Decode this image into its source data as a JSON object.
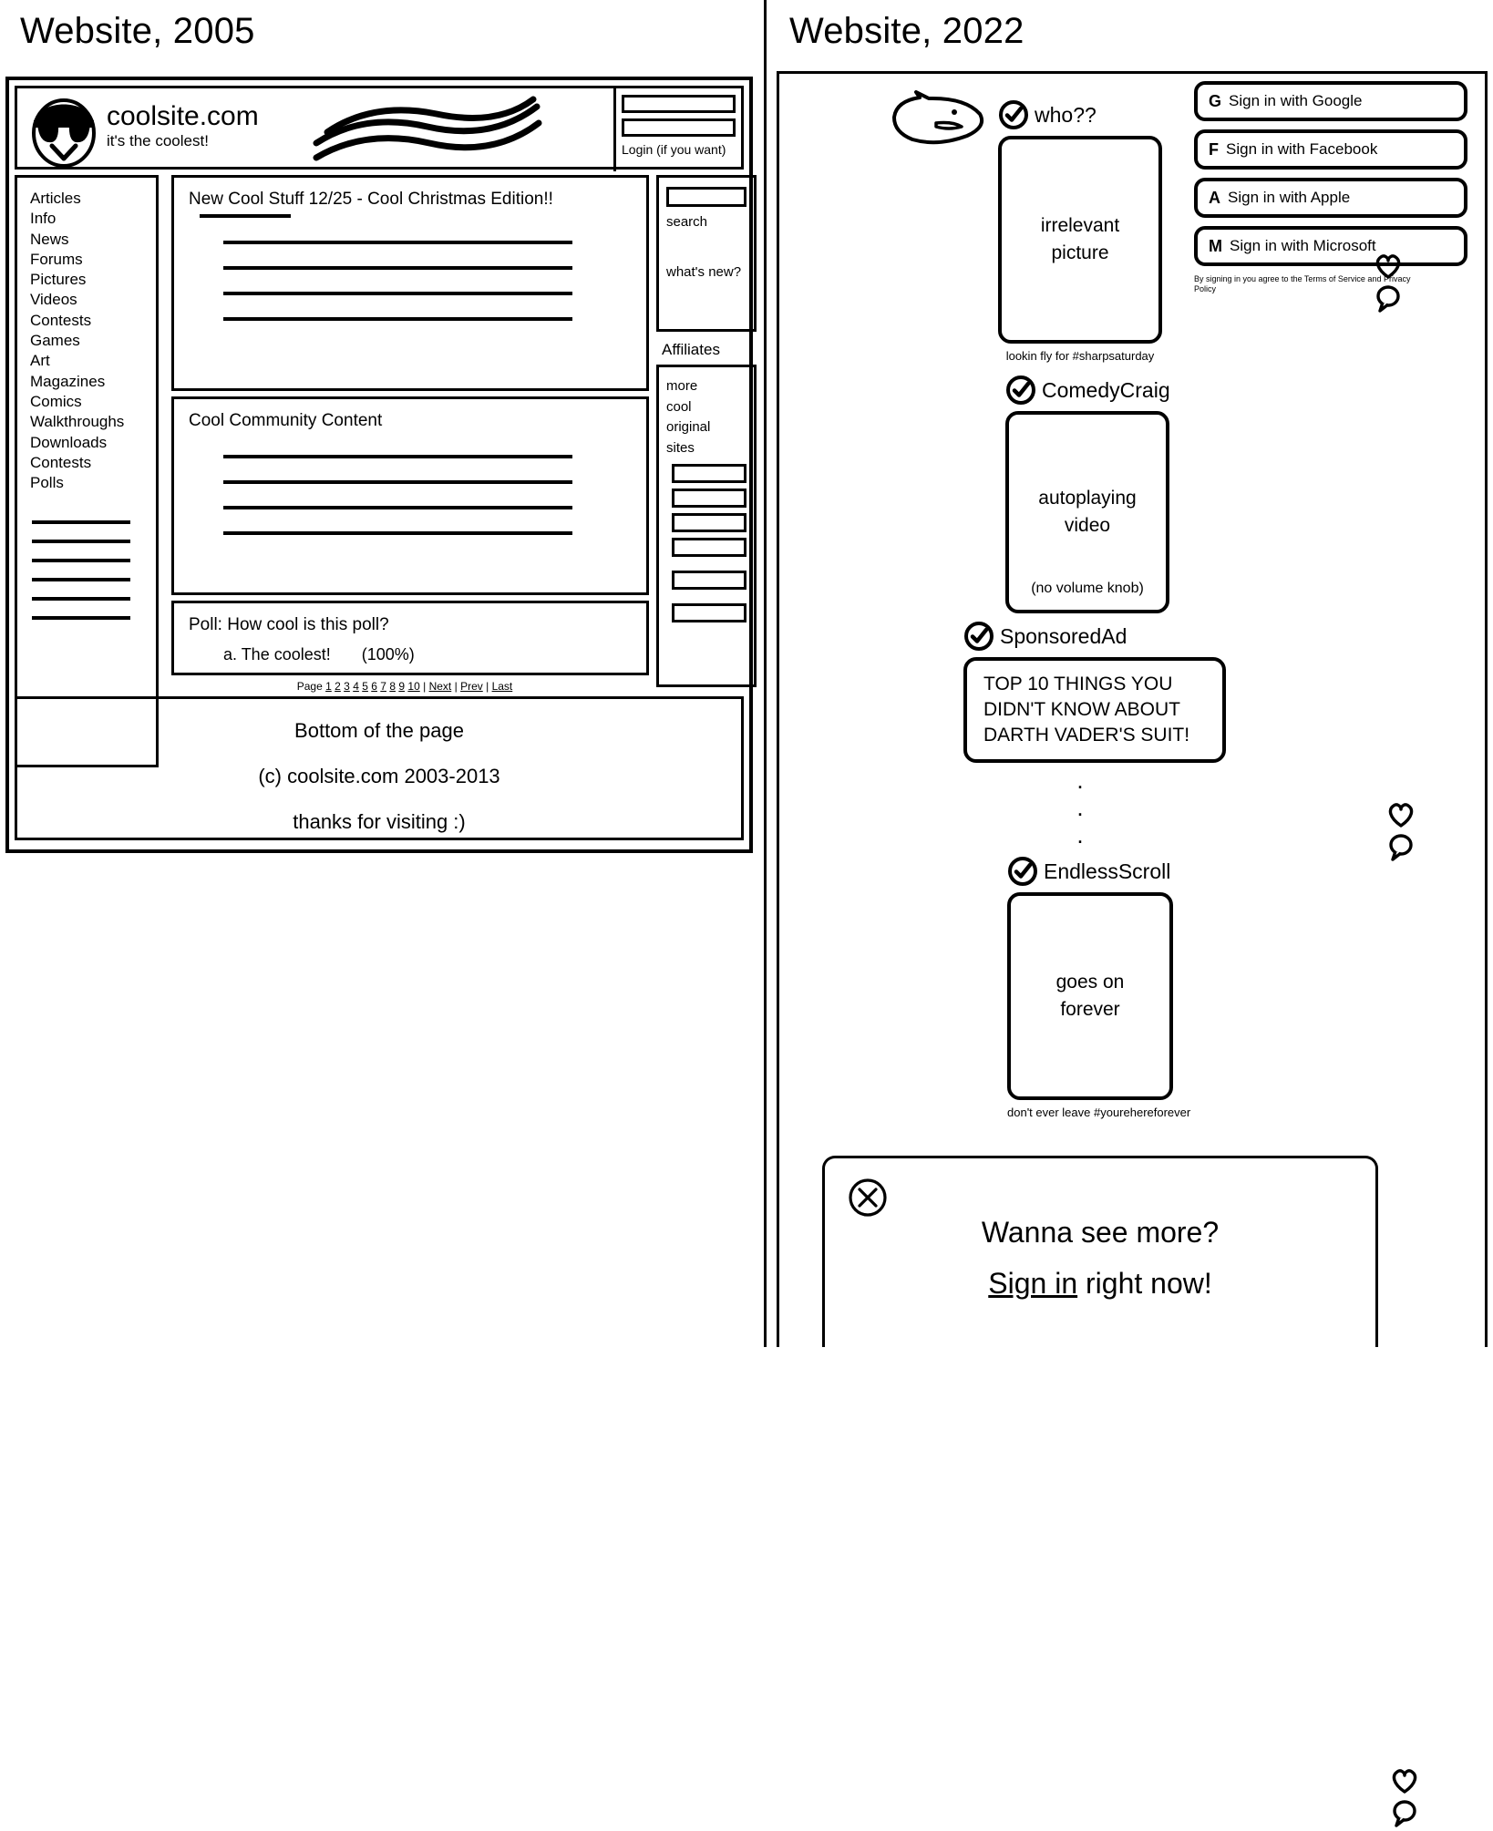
{
  "left_panel": {
    "title": "Website, 2005",
    "header": {
      "logo_icon": "cool-smiley-sunglasses-icon",
      "brand_name": "coolsite.com",
      "tagline": "it's the coolest!",
      "decoration_icon": "swoosh-lines-icon",
      "login_label": "Login (if you want)"
    },
    "nav_items": [
      "Articles",
      "Info",
      "News",
      "Forums",
      "Pictures",
      "Videos",
      "Contests",
      "Games",
      "Art",
      "Magazines",
      "Comics",
      "Walkthroughs",
      "Downloads",
      "Contests",
      "Polls"
    ],
    "nav_placeholder_rule_count": 6,
    "news_box": {
      "heading": "New Cool Stuff 12/25 - Cool Christmas Edition!!",
      "line_count": 4
    },
    "community_box": {
      "heading": "Cool Community Content",
      "line_count": 4
    },
    "poll_box": {
      "heading": "Poll: How cool is this poll?",
      "option_label": "a. The coolest!",
      "option_percent": "(100%)"
    },
    "search_box": {
      "search_label": "search",
      "whats_new_label": "what's new?"
    },
    "affiliates": {
      "title": "Affiliates",
      "words": [
        "more",
        "cool",
        "original",
        "sites"
      ],
      "button_count": 6
    },
    "pager": {
      "prefix": "Page",
      "pages": [
        "1",
        "2",
        "3",
        "4",
        "5",
        "6",
        "7",
        "8",
        "9",
        "10"
      ],
      "links": [
        "Next",
        "Prev",
        "Last"
      ],
      "separator": "|"
    },
    "footer": {
      "line1": "Bottom of the page",
      "line2": "(c) coolsite.com 2003-2013",
      "line3": "thanks for visiting :)"
    }
  },
  "right_panel": {
    "title": "Website, 2022",
    "blob_icon": "doodle-blob-icon",
    "posts": [
      {
        "verified_icon": "verified-check-icon",
        "username": "who??",
        "card_text": "irrelevant\npicture",
        "card_line1": "irrelevant",
        "card_line2": "picture",
        "caption": "lookin fly for #sharpsaturday",
        "like_icon": "heart-icon",
        "comment_icon": "speech-bubble-icon"
      },
      {
        "verified_icon": "verified-check-icon",
        "username": "ComedyCraig",
        "card_line1": "autoplaying",
        "card_line2": "video",
        "subnote": "(no volume knob)",
        "like_icon": "heart-icon",
        "comment_icon": "speech-bubble-icon"
      },
      {
        "verified_icon": "verified-check-icon",
        "username": "SponsoredAd",
        "ad_text": "TOP 10 THINGS YOU DIDN'T KNOW ABOUT DARTH VADER'S SUIT!"
      },
      {
        "verified_icon": "verified-check-icon",
        "username": "EndlessScroll",
        "card_line1": "goes on",
        "card_line2": "forever",
        "caption": "don't ever leave #yourehereforever",
        "like_icon": "heart-icon",
        "comment_icon": "speech-bubble-icon"
      }
    ],
    "ellipsis": ".\n.\n.",
    "signin_buttons": [
      {
        "glyph": "G",
        "label": "Sign in with Google",
        "icon": "google-icon"
      },
      {
        "glyph": "F",
        "label": "Sign in with Facebook",
        "icon": "facebook-icon"
      },
      {
        "glyph": "A",
        "label": "Sign in with Apple",
        "icon": "apple-icon"
      },
      {
        "glyph": "M",
        "label": "Sign in with Microsoft",
        "icon": "microsoft-icon"
      }
    ],
    "terms_text": "By signing in you agree to the Terms of Service and Privacy Policy",
    "modal": {
      "close_icon": "close-circle-icon",
      "line1": "Wanna see more?",
      "link_text": "Sign in",
      "line2_rest": " right now!"
    }
  },
  "colors": {
    "ink": "#000000",
    "paper": "#ffffff"
  }
}
